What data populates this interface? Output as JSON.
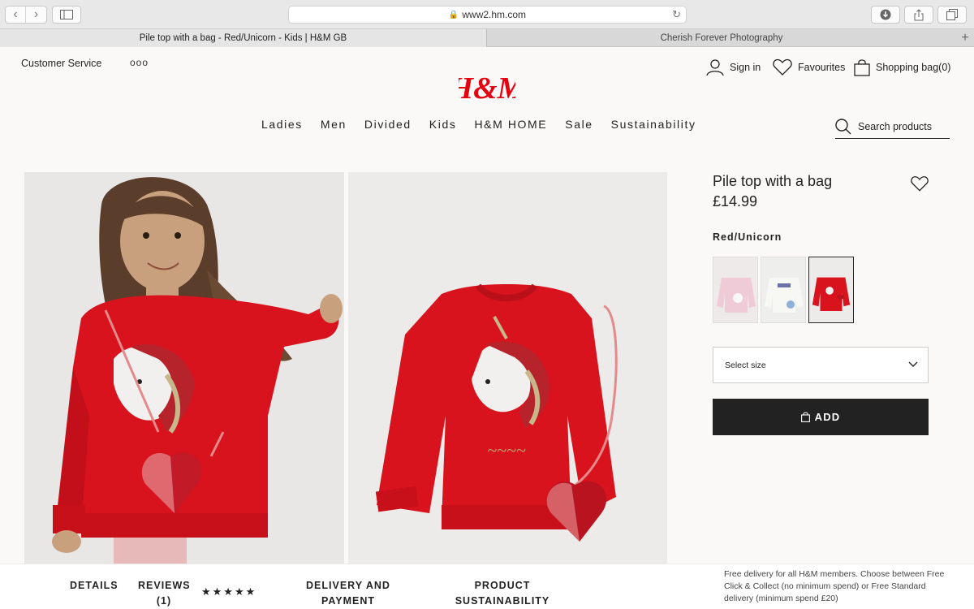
{
  "browser": {
    "url": "www2.hm.com",
    "tabs": [
      {
        "label": "Pile top with a bag - Red/Unicorn - Kids | H&M GB"
      },
      {
        "label": "Cherish Forever Photography"
      }
    ]
  },
  "header": {
    "customer_service": "Customer Service",
    "more": "ooo",
    "sign_in": "Sign in",
    "favourites": "Favourites",
    "shopping_bag": "Shopping bag(0)",
    "logo_text": "H&M"
  },
  "nav": [
    "Ladies",
    "Men",
    "Divided",
    "Kids",
    "H&M HOME",
    "Sale",
    "Sustainability"
  ],
  "search": {
    "placeholder": "Search products"
  },
  "product": {
    "title": "Pile top with a bag",
    "price": "£14.99",
    "color": "Red/Unicorn",
    "select_size": "Select size",
    "add_label": "ADD"
  },
  "bottom": {
    "details": "DETAILS",
    "reviews": "REVIEWS",
    "reviews_count": "(1)",
    "stars": "★★★★★",
    "delivery_line1": "DELIVERY AND",
    "delivery_line2": "PAYMENT",
    "sustain_line1": "PRODUCT",
    "sustain_line2": "SUSTAINABILITY",
    "delivery_note": "Free delivery for all H&M members. Choose between Free Click & Collect (no minimum spend) or Free Standard delivery (minimum spend £20)"
  },
  "colors": {
    "brand_red": "#e50010",
    "sweater_red": "#d8131e",
    "button_dark": "#222222"
  }
}
